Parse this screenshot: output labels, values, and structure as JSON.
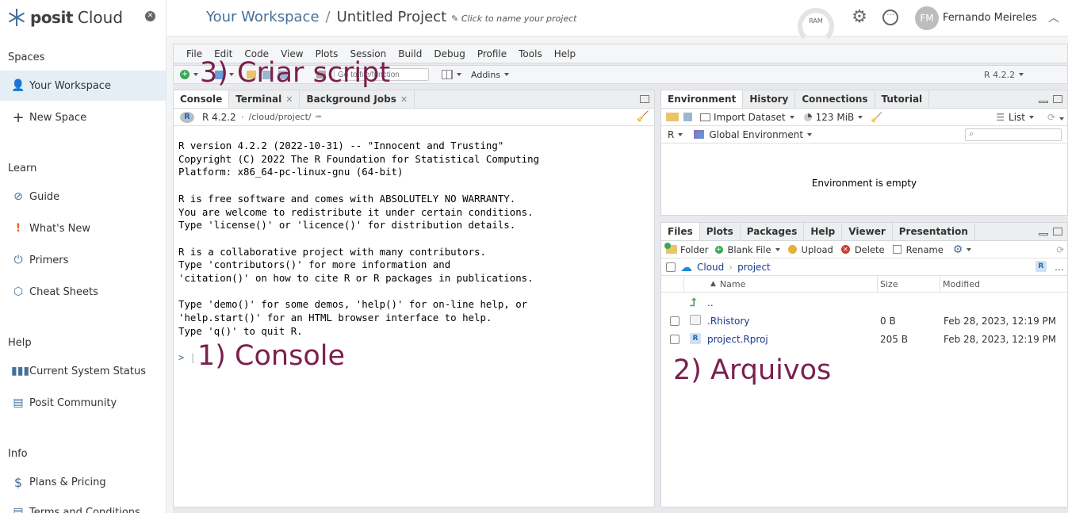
{
  "nav": {
    "logo_bold": "posit",
    "logo_light": "Cloud",
    "sections": {
      "spaces": "Spaces",
      "learn": "Learn",
      "help": "Help",
      "info": "Info"
    },
    "items": {
      "your_workspace": "Your Workspace",
      "new_space": "New Space",
      "guide": "Guide",
      "whats_new": "What's New",
      "primers": "Primers",
      "cheat_sheets": "Cheat Sheets",
      "system_status": "Current System Status",
      "community": "Posit Community",
      "plans": "Plans & Pricing",
      "terms": "Terms and Conditions"
    }
  },
  "header": {
    "workspace": "Your Workspace",
    "separator": "/",
    "project": "Untitled Project",
    "hint": "Click to name your project",
    "ram_label": "RAM",
    "avatar_initials": "FM",
    "user_name": "Fernando Meireles"
  },
  "menu": [
    "File",
    "Edit",
    "Code",
    "View",
    "Plots",
    "Session",
    "Build",
    "Debug",
    "Profile",
    "Tools",
    "Help"
  ],
  "toolbar": {
    "goto_placeholder": "Go to file/function",
    "addins": "Addins",
    "r_version": "R 4.2.2"
  },
  "console": {
    "tabs": {
      "console": "Console",
      "terminal": "Terminal",
      "background": "Background Jobs"
    },
    "r_version": "R 4.2.2",
    "dot": "·",
    "path": "/cloud/project/",
    "output": "R version 4.2.2 (2022-10-31) -- \"Innocent and Trusting\"\nCopyright (C) 2022 The R Foundation for Statistical Computing\nPlatform: x86_64-pc-linux-gnu (64-bit)\n\nR is free software and comes with ABSOLUTELY NO WARRANTY.\nYou are welcome to redistribute it under certain conditions.\nType 'license()' or 'licence()' for distribution details.\n\nR is a collaborative project with many contributors.\nType 'contributors()' for more information and\n'citation()' on how to cite R or R packages in publications.\n\nType 'demo()' for some demos, 'help()' for on-line help, or\n'help.start()' for an HTML browser interface to help.\nType 'q()' to quit R.",
    "prompt": ">"
  },
  "environment": {
    "tabs": {
      "environment": "Environment",
      "history": "History",
      "connections": "Connections",
      "tutorial": "Tutorial"
    },
    "import": "Import Dataset",
    "memory": "123 MiB",
    "list": "List",
    "lang": "R",
    "scope": "Global Environment",
    "empty": "Environment is empty"
  },
  "files": {
    "tabs": {
      "files": "Files",
      "plots": "Plots",
      "packages": "Packages",
      "help": "Help",
      "viewer": "Viewer",
      "presentation": "Presentation"
    },
    "actions": {
      "folder": "Folder",
      "blank": "Blank File",
      "upload": "Upload",
      "delete": "Delete",
      "rename": "Rename"
    },
    "path": {
      "cloud": "Cloud",
      "project": "project"
    },
    "columns": {
      "name": "Name",
      "size": "Size",
      "modified": "Modified"
    },
    "up": "..",
    "rows": [
      {
        "name": ".Rhistory",
        "size": "0 B",
        "modified": "Feb 28, 2023, 12:19 PM"
      },
      {
        "name": "project.Rproj",
        "size": "205 B",
        "modified": "Feb 28, 2023, 12:19 PM"
      }
    ]
  },
  "annotations": {
    "script": "3) Criar script",
    "console": "1) Console",
    "files": "2) Arquivos"
  }
}
